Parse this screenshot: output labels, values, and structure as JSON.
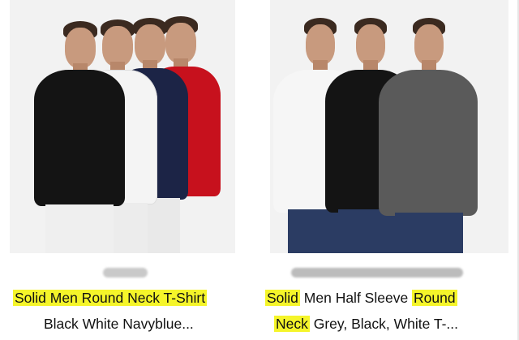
{
  "products": [
    {
      "title_line1_highlight": "Solid Men Round Neck T-Shirt",
      "title_line2": "Black White Navyblue..."
    },
    {
      "title_line1_parts": [
        {
          "text": "Solid",
          "highlight": true
        },
        {
          "text": " Men Half Sleeve ",
          "highlight": false
        },
        {
          "text": "Round",
          "highlight": true
        }
      ],
      "title_line2_parts": [
        {
          "text": "Neck",
          "highlight": true
        },
        {
          "text": " Grey, Black, White T-...",
          "highlight": false
        }
      ]
    }
  ],
  "colors": {
    "highlight": "#f5f52a",
    "shirt_black": "#141414",
    "shirt_white": "#f4f4f4",
    "shirt_navy": "#1c2446",
    "shirt_red": "#c7111d",
    "shirt_grey": "#5a5a5a",
    "jeans_blue": "#2b3c63"
  }
}
